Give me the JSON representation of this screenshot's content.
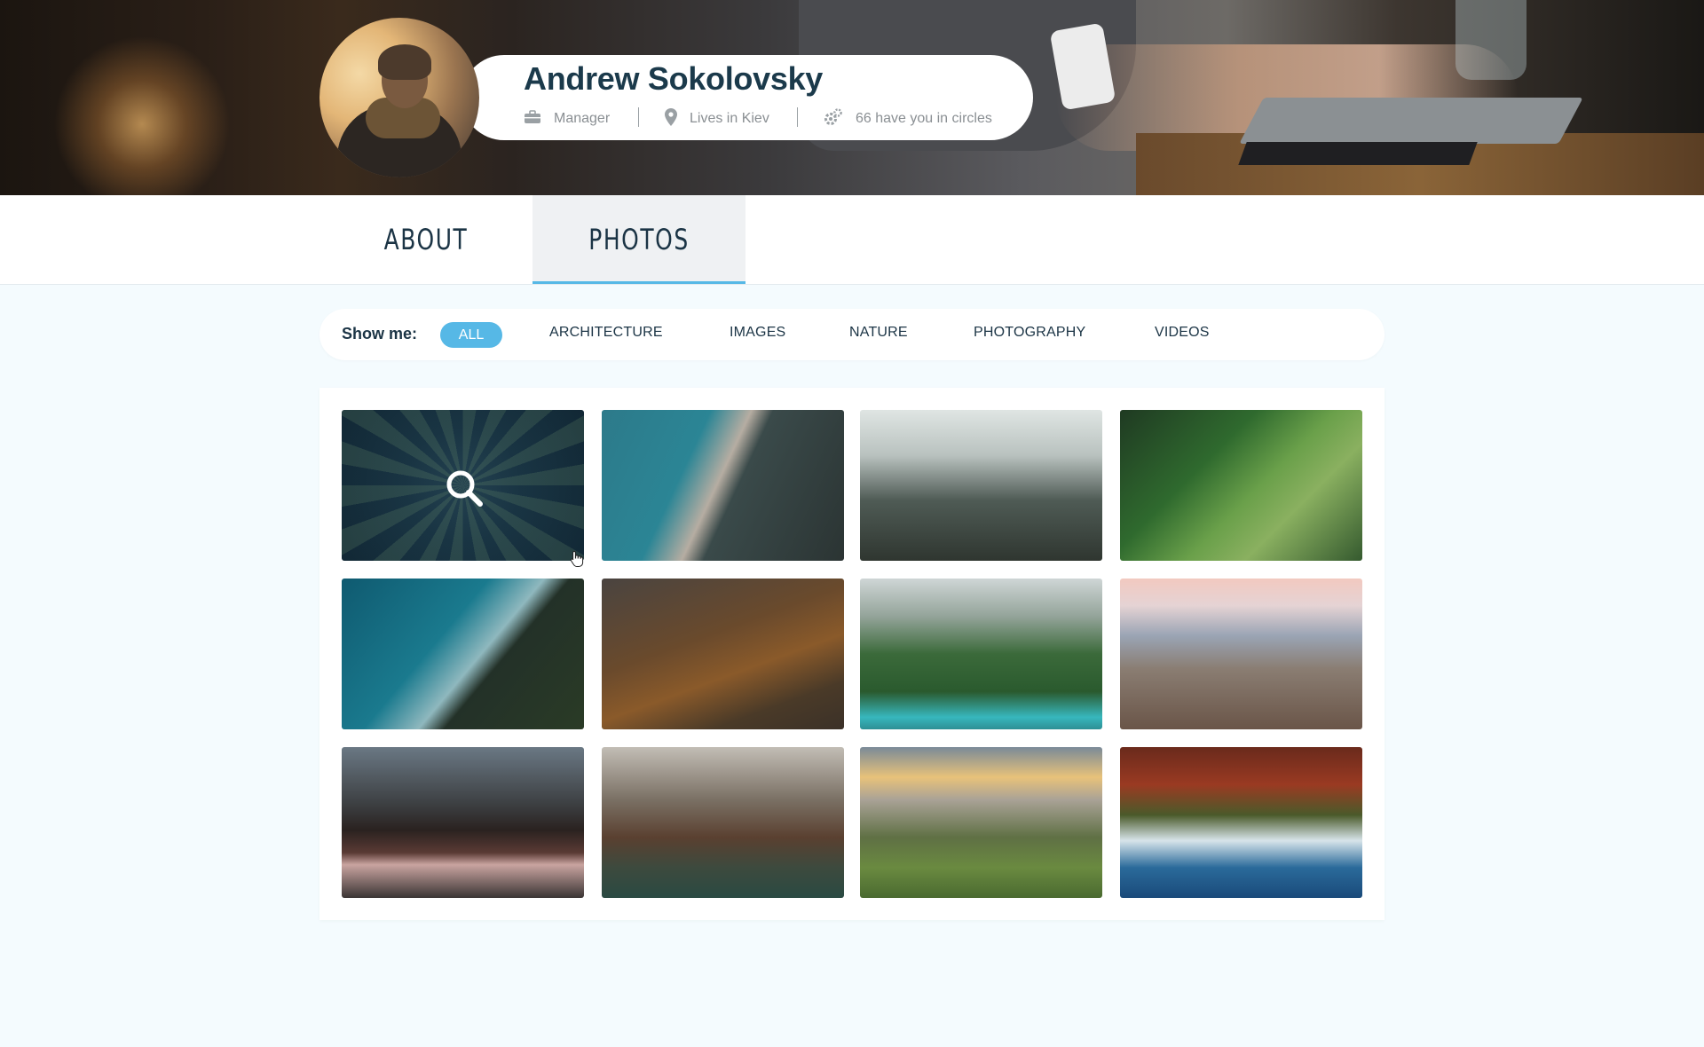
{
  "profile": {
    "name": "Andrew Sokolovsky",
    "job": "Manager",
    "location": "Lives in Kiev",
    "circles": "66 have you in circles"
  },
  "tabs": [
    {
      "label": "ABOUT",
      "active": false
    },
    {
      "label": "PHOTOS",
      "active": true
    }
  ],
  "filter": {
    "label": "Show me:",
    "options": [
      "ALL",
      "ARCHITECTURE",
      "IMAGES",
      "NATURE",
      "PHOTOGRAPHY",
      "VIDEOS"
    ],
    "selected": "ALL"
  },
  "colors": {
    "accent": "#56b8e6",
    "title": "#1b3a4b",
    "page_bg": "#f4fbfe"
  },
  "gallery": {
    "photos": [
      "forest-aerial",
      "ocean-shore",
      "misty-forest",
      "green-hills-path",
      "turquoise-lake-shore",
      "autumn-valley",
      "alpine-lake",
      "snowy-mountains",
      "mountain-reflection",
      "lake-cabin",
      "sunset-cliffs",
      "ocean-waves-rocks"
    ],
    "hover_icon": "search-icon"
  }
}
